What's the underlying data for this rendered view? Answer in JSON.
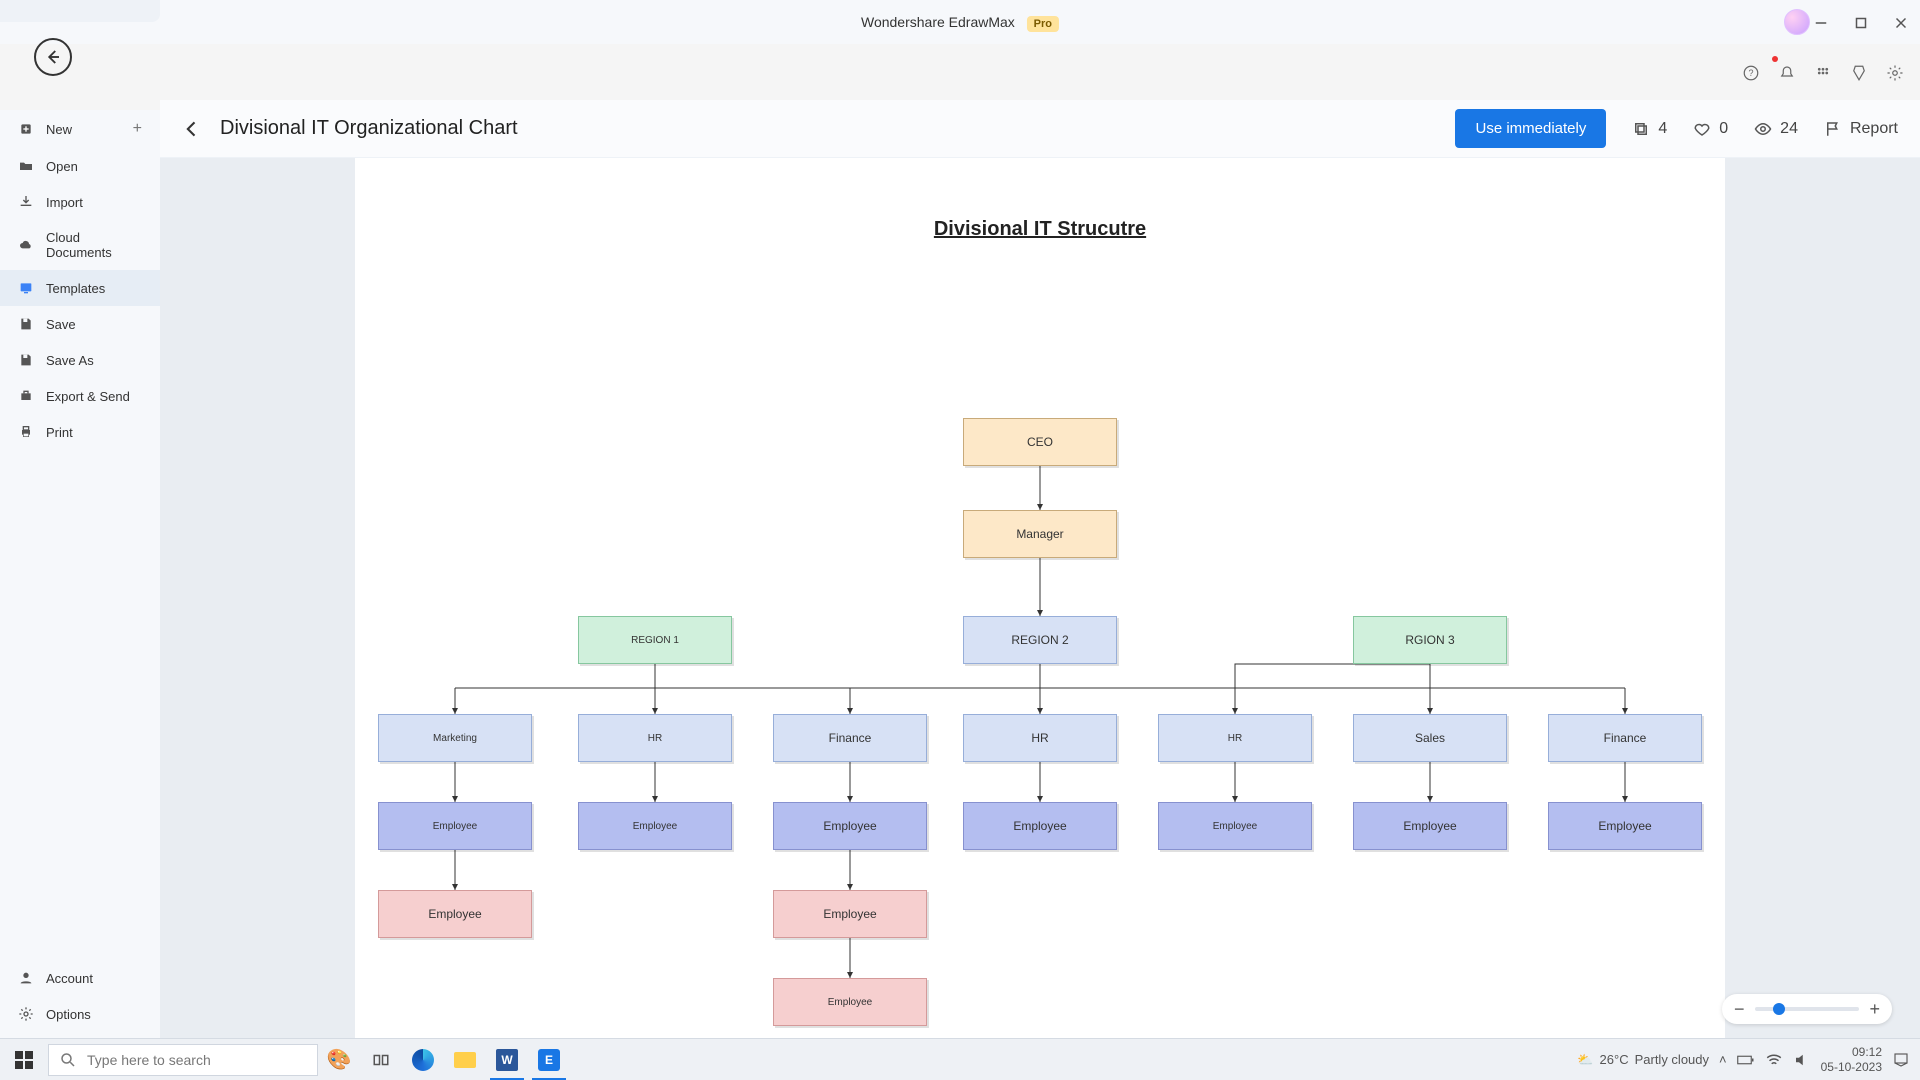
{
  "app": {
    "name": "Wondershare EdrawMax",
    "edition": "Pro"
  },
  "sidebar": {
    "items": [
      {
        "label": "New"
      },
      {
        "label": "Open"
      },
      {
        "label": "Import"
      },
      {
        "label": "Cloud Documents"
      },
      {
        "label": "Templates"
      },
      {
        "label": "Save"
      },
      {
        "label": "Save As"
      },
      {
        "label": "Export & Send"
      },
      {
        "label": "Print"
      }
    ],
    "bottom": [
      {
        "label": "Account"
      },
      {
        "label": "Options"
      }
    ]
  },
  "header": {
    "title": "Divisional IT Organizational Chart",
    "use_btn": "Use immediately",
    "copies": "4",
    "likes": "0",
    "views": "24",
    "report": "Report"
  },
  "diagram": {
    "title": "Divisional IT Strucutre",
    "nodes": {
      "ceo": "CEO",
      "manager": "Manager",
      "region1": "REGION 1",
      "region2": "REGION 2",
      "region3": "RGION 3",
      "marketing": "Marketing",
      "hr": "HR",
      "finance": "Finance",
      "sales": "Sales",
      "employee": "Employee"
    }
  },
  "taskbar": {
    "search_placeholder": "Type here to search",
    "weather_temp": "26°C",
    "weather_desc": "Partly cloudy",
    "time": "09:12",
    "date": "05-10-2023"
  }
}
